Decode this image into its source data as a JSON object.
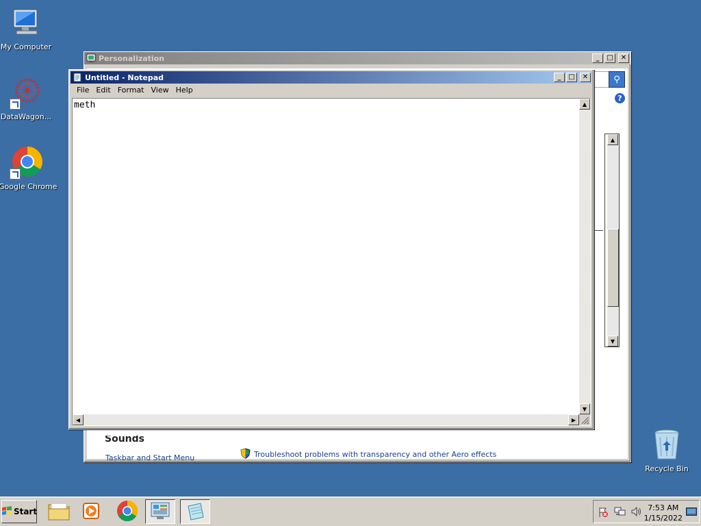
{
  "desktop": {
    "icons": [
      {
        "label": "My Computer"
      },
      {
        "label": "DataWagon..."
      },
      {
        "label": "Google Chrome"
      },
      {
        "label": "Recycle Bin"
      }
    ]
  },
  "personalization": {
    "title": "Personalization",
    "taskbar_link": "Taskbar and Start Menu",
    "troubleshoot_link": "Troubleshoot problems with transparency and other Aero effects",
    "partial_text": "Sounds"
  },
  "notepad": {
    "title": "Untitled - Notepad",
    "menu": [
      "File",
      "Edit",
      "Format",
      "View",
      "Help"
    ],
    "text": "meth"
  },
  "taskbar": {
    "start_label": "Start",
    "items": [
      "explorer-icon",
      "media-player-icon",
      "chrome-icon",
      "control-panel-icon",
      "notepad-icon"
    ]
  },
  "tray": {
    "time": "7:53 AM",
    "date": "1/15/2022"
  },
  "colors": {
    "desktop": "#3a6ea5",
    "active_title": "#0a246a",
    "inactive_title": "#808080"
  }
}
